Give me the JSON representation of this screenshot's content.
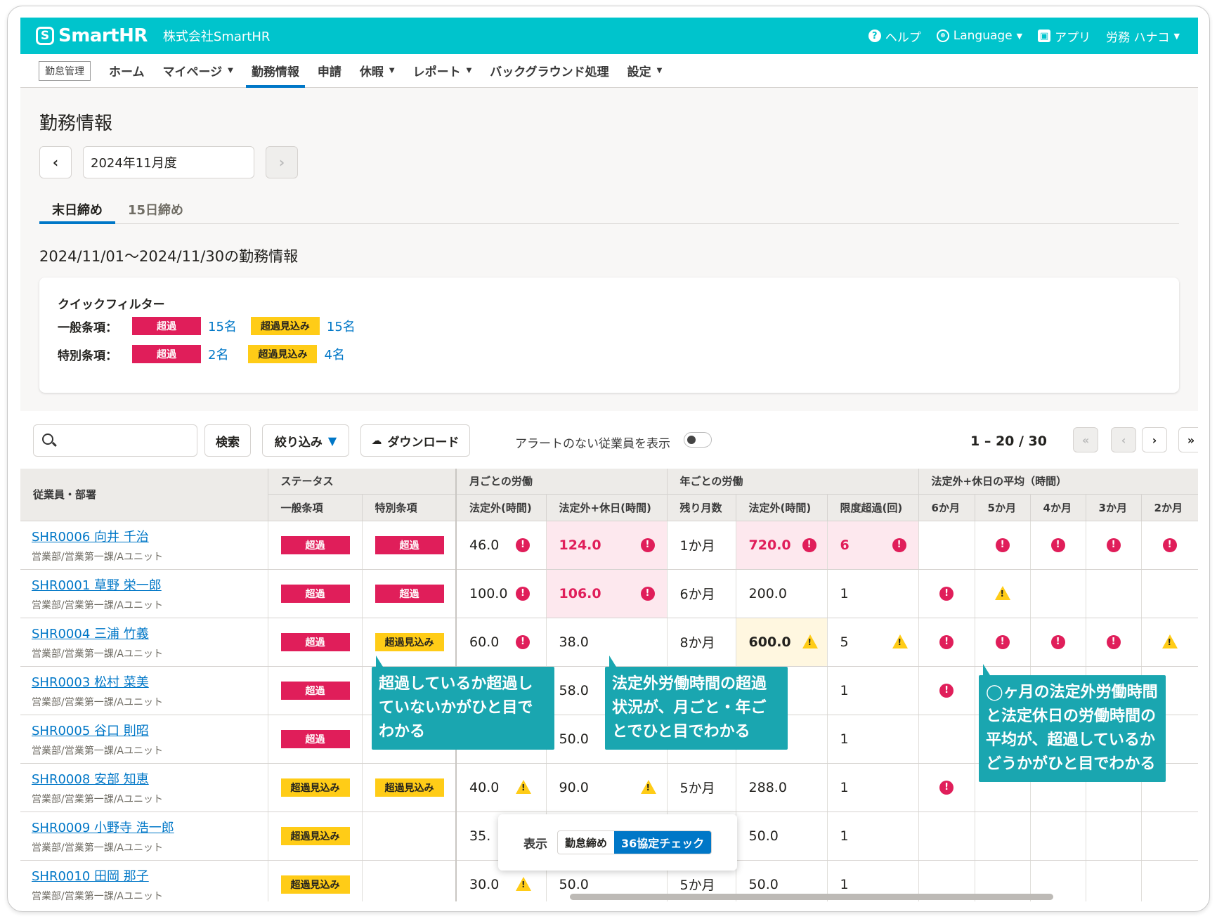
{
  "header": {
    "logo_mark": "S",
    "logo": "SmartHR",
    "company": "株式会社SmartHR",
    "help": "ヘルプ",
    "language": "Language",
    "apps": "アプリ",
    "user": "労務 ハナコ"
  },
  "nav": {
    "badge": "勤怠管理",
    "items": [
      "ホーム",
      "マイページ",
      "勤務情報",
      "申請",
      "休暇",
      "レポート",
      "バックグラウンド処理",
      "設定"
    ]
  },
  "page": {
    "title": "勤務情報",
    "month": "2024年11月度",
    "tabs": [
      "末日締め",
      "15日締め"
    ],
    "period": "2024/11/01〜2024/11/30の勤務情報"
  },
  "quick_filter": {
    "title": "クイックフィルター",
    "general_label": "一般条項：",
    "special_label": "特別条項：",
    "over": "超過",
    "forecast": "超過見込み",
    "general_over_count": "15名",
    "general_forecast_count": "15名",
    "special_over_count": "2名",
    "special_forecast_count": "4名"
  },
  "toolbar": {
    "search_placeholder": "",
    "search_button": "検索",
    "filter_button": "絞り込み",
    "download_button": "ダウンロード",
    "toggle_label": "アラートのない従業員を表示",
    "pager": "1 – 20 / 30"
  },
  "table": {
    "col_employee": "従業員・部署",
    "grp_status": "ステータス",
    "grp_monthly": "月ごとの労働",
    "grp_yearly": "年ごとの労働",
    "grp_avg": "法定外+休日の平均（時間）",
    "sub": [
      "一般条項",
      "特別条項",
      "法定外(時間)",
      "法定外+休日(時間)",
      "残り月数",
      "法定外(時間)",
      "限度超過(回)",
      "6か月",
      "5か月",
      "4か月",
      "3か月",
      "2か月"
    ],
    "dept": "営業部/営業第一課/Aユニット",
    "rows": [
      {
        "name": "SHR0006 向井 千治",
        "gen": "超過",
        "spe": "超過",
        "m1": "46.0",
        "m2": "124.0",
        "rem": "1か月",
        "y1": "720.0",
        "lim": "6"
      },
      {
        "name": "SHR0001 草野 栄一郎",
        "gen": "超過",
        "spe": "超過",
        "m1": "100.0",
        "m2": "106.0",
        "rem": "6か月",
        "y1": "200.0",
        "lim": "1"
      },
      {
        "name": "SHR0004 三浦 竹義",
        "gen": "超過",
        "spe": "超過見込み",
        "m1": "60.0",
        "m2": "38.0",
        "rem": "8か月",
        "y1": "600.0",
        "lim": "5"
      },
      {
        "name": "SHR0003 松村 菜美",
        "gen": "超過",
        "spe": "",
        "m1": "",
        "m2": "58.0",
        "rem": "",
        "y1": "",
        "lim": "1"
      },
      {
        "name": "SHR0005 谷口 則昭",
        "gen": "超過",
        "spe": "",
        "m1": "",
        "m2": "50.0",
        "rem": "",
        "y1": "",
        "lim": "1"
      },
      {
        "name": "SHR0008 安部 知恵",
        "gen": "超過見込み",
        "spe": "超過見込み",
        "m1": "40.0",
        "m2": "90.0",
        "rem": "5か月",
        "y1": "288.0",
        "lim": "1"
      },
      {
        "name": "SHR0009 小野寺 浩一郎",
        "gen": "超過見込み",
        "spe": "",
        "m1": "35.",
        "m2": "",
        "rem": "",
        "y1": "50.0",
        "lim": "1"
      },
      {
        "name": "SHR0010 田岡 那子",
        "gen": "超過見込み",
        "spe": "",
        "m1": "30.0",
        "m2": "50.0",
        "rem": "5か月",
        "y1": "50.0",
        "lim": "1"
      }
    ]
  },
  "callouts": {
    "status": "超過しているか超過していないかがひと目でわかる",
    "monthly": "法定外労働時間の超過状況が、月ごと・年ごとでひと目でわかる",
    "avg": "◯ヶ月の法定外労働時間と法定休日の労働時間の平均が、超過しているかどうかがひと目でわかる"
  },
  "view_switch": {
    "label": "表示",
    "opt1": "勤怠締め",
    "opt2": "36協定チェック"
  },
  "colors": {
    "header": "#00c4cc",
    "accent": "#0077c7",
    "danger": "#e01e5a",
    "warning": "#ffcc17",
    "callout": "#1aa6b0"
  }
}
